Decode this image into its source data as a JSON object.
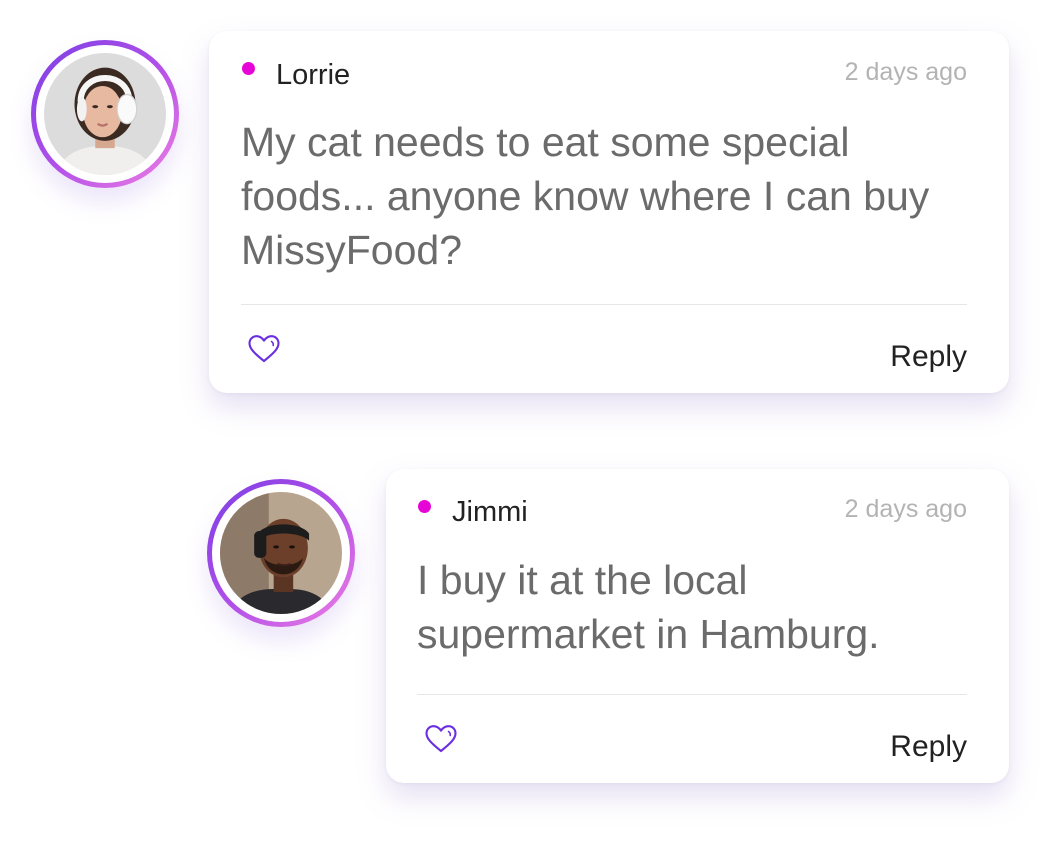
{
  "comments": [
    {
      "author": "Lorrie",
      "time": "2 days ago",
      "message": "My cat needs to eat some special foods... anyone know where I can buy MissyFood?",
      "reply_label": "Reply",
      "like_icon": "heart-outline-icon",
      "avatar": "woman-with-headphones-avatar"
    },
    {
      "author": "Jimmi",
      "time": "2 days ago",
      "message": "I buy it at the local supermarket in Hamburg.",
      "reply_label": "Reply",
      "like_icon": "heart-outline-icon",
      "avatar": "man-with-headband-avatar"
    }
  ],
  "colors": {
    "online_dot": "#e605d6",
    "avatar_ring_start": "#7b3fe4",
    "avatar_ring_end": "#ef7fe3",
    "heart_outline": "#6a2ee0",
    "message_text": "#6b6b6b",
    "timestamp_text": "#b3b3b3"
  }
}
